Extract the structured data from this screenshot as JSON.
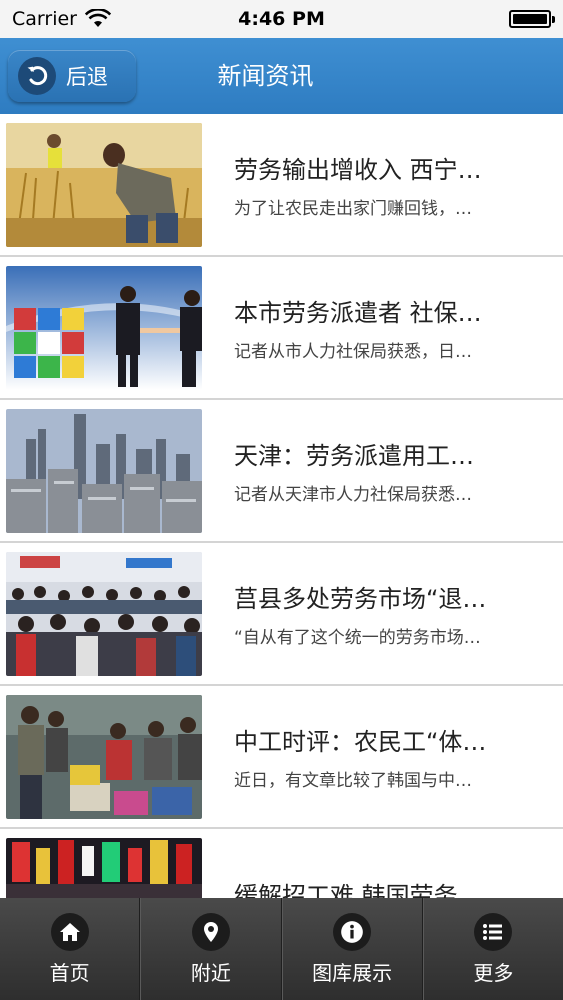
{
  "status_bar": {
    "carrier": "Carrier",
    "time": "4:46 PM"
  },
  "nav": {
    "back_label": "后退",
    "title": "新闻资讯"
  },
  "news": [
    {
      "title": "劳务输出增收入 西宁…",
      "summary": "为了让农民走出家门赚回钱，…",
      "thumb": "wheat-harvest"
    },
    {
      "title": "本市劳务派遣者 社保…",
      "summary": "记者从市人力社保局获悉，日…",
      "thumb": "business-handshake"
    },
    {
      "title": "天津：劳务派遣用工…",
      "summary": "记者从天津市人力社保局获悉…",
      "thumb": "city-skyline"
    },
    {
      "title": "莒县多处劳务市场“退…",
      "summary": "“自从有了这个统一的劳务市场…",
      "thumb": "crowd-market"
    },
    {
      "title": "中工时评：农民工“体…",
      "summary": "近日，有文章比较了韩国与中…",
      "thumb": "workers-luggage"
    },
    {
      "title": "缓解招工难 韩国劳务…",
      "summary": "",
      "thumb": "street-signs"
    }
  ],
  "tabs": [
    {
      "label": "首页",
      "icon": "home-icon"
    },
    {
      "label": "附近",
      "icon": "location-pin-icon"
    },
    {
      "label": "图库展示",
      "icon": "info-icon"
    },
    {
      "label": "更多",
      "icon": "list-icon"
    }
  ],
  "colors": {
    "nav_blue": "#3584c9",
    "tab_bar": "#3a3a3a"
  }
}
